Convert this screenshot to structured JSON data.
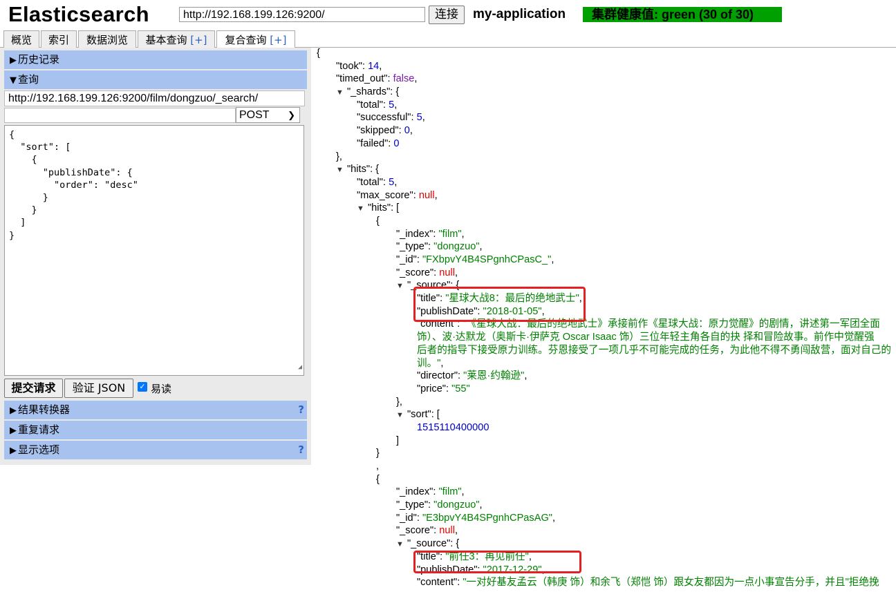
{
  "header": {
    "logo": "Elasticsearch",
    "url": "http://192.168.199.126:9200/",
    "connect_label": "连接",
    "cluster_name": "my-application",
    "health": "集群健康值: green (30 of 30)",
    "health_color": "#00a000"
  },
  "tabs": [
    {
      "label": "概览",
      "plus": ""
    },
    {
      "label": "索引",
      "plus": ""
    },
    {
      "label": "数据浏览",
      "plus": ""
    },
    {
      "label": "基本查询 ",
      "plus": "[+]"
    },
    {
      "label": "复合查询 ",
      "plus": "[+]",
      "active": true
    }
  ],
  "left": {
    "history_label": "历史记录",
    "query_label": "查询",
    "query_url": "http://192.168.199.126:9200/film/dongzuo/_search/",
    "query_path": "",
    "method": "POST",
    "body": "{\n  \"sort\": [\n    {\n      \"publishDate\": {\n        \"order\": \"desc\"\n      }\n    }\n  ]\n}",
    "submit_label": "提交请求",
    "validate_label": "验证 JSON",
    "pretty_label": "易读",
    "pretty_checked": true,
    "transformer_label": "结果转换器",
    "repeat_label": "重复请求",
    "display_label": "显示选项",
    "help": "?"
  },
  "response": {
    "took": "14",
    "timed_out": "false",
    "shards": {
      "total": "5",
      "successful": "5",
      "skipped": "0",
      "failed": "0"
    },
    "hits_total": "5",
    "max_score": "null",
    "hit1": {
      "index": "\"film\"",
      "type": "\"dongzuo\"",
      "id": "\"FXbpvY4B4SPgnhCPasC_\"",
      "score": "null",
      "title": "\"星球大战8：最后的绝地武士\"",
      "publishDate": "\"2018-01-05\"",
      "content_1": "\"《星球大战：最后的绝地武士》承接前作《星球大战：原力觉醒》的剧情，讲述第一军团全面",
      "content_2": "饰）、波·达默龙（奥斯卡·伊萨克 Oscar Isaac 饰）三位年轻主角各自的抉 择和冒险故事。前作中觉醒强",
      "content_3": "后者的指导下接受原力训练。芬恩接受了一项几乎不可能完成的任务，为此他不得不勇闯敌营，面对自己的",
      "content_4": "训。\"",
      "director": "\"莱恩·约翰逊\"",
      "price": "\"55\"",
      "sort": "1515110400000"
    },
    "hit2": {
      "index": "\"film\"",
      "type": "\"dongzuo\"",
      "id": "\"E3bpvY4B4SPgnhCPasAG\"",
      "score": "null",
      "title": "\"前任3：再见前任\"",
      "publishDate": "\"2017-12-29\"",
      "content_1": "\"一对好基友孟云（韩庚 饰）和余飞（郑恺 饰）跟女友都因为一点小事宣告分手，并且\"拒绝挽"
    }
  }
}
